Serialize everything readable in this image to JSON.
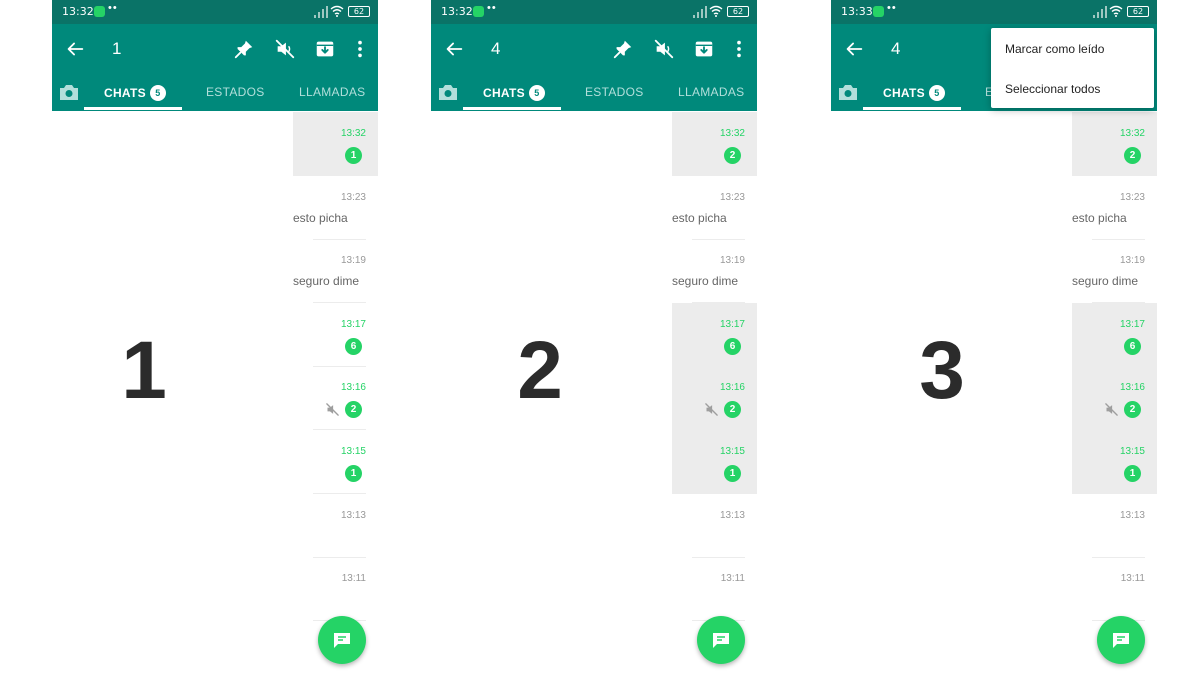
{
  "colors": {
    "status_bar": "#0a7367",
    "toolbar": "#00897b",
    "accent_green": "#25d366",
    "selected_row": "#ececec"
  },
  "tabs": {
    "chats_label": "CHATS",
    "chats_badge": "5",
    "states_label": "ESTADOS",
    "calls_label": "LLAMADAS"
  },
  "steps": [
    {
      "number": "1",
      "status_time": "13:32",
      "battery": "62",
      "selected_count": "1",
      "rows": [
        {
          "time": "13:32",
          "badge": "1",
          "unread": true,
          "selected": true
        },
        {
          "time": "13:23",
          "preview": "esto picha"
        },
        {
          "time": "13:19",
          "preview": "seguro dime"
        },
        {
          "time": "13:17",
          "badge": "6",
          "unread": true
        },
        {
          "time": "13:16",
          "badge": "2",
          "unread": true,
          "muted": true
        },
        {
          "time": "13:15",
          "badge": "1",
          "unread": true
        },
        {
          "time": "13:13"
        },
        {
          "time": "13:11"
        }
      ]
    },
    {
      "number": "2",
      "status_time": "13:32",
      "battery": "62",
      "selected_count": "4",
      "rows": [
        {
          "time": "13:32",
          "badge": "2",
          "unread": true,
          "selected": true
        },
        {
          "time": "13:23",
          "preview": "esto picha"
        },
        {
          "time": "13:19",
          "preview": "seguro dime"
        },
        {
          "time": "13:17",
          "badge": "6",
          "unread": true,
          "selected": true
        },
        {
          "time": "13:16",
          "badge": "2",
          "unread": true,
          "muted": true,
          "selected": true
        },
        {
          "time": "13:15",
          "badge": "1",
          "unread": true,
          "selected": true
        },
        {
          "time": "13:13"
        },
        {
          "time": "13:11"
        }
      ]
    },
    {
      "number": "3",
      "status_time": "13:33",
      "battery": "62",
      "selected_count": "4",
      "menu": {
        "mark_read": "Marcar como leído",
        "select_all": "Seleccionar todos"
      },
      "rows": [
        {
          "time": "13:32",
          "badge": "2",
          "unread": true,
          "selected": true
        },
        {
          "time": "13:23",
          "preview": "esto picha"
        },
        {
          "time": "13:19",
          "preview": "seguro dime"
        },
        {
          "time": "13:17",
          "badge": "6",
          "unread": true,
          "selected": true
        },
        {
          "time": "13:16",
          "badge": "2",
          "unread": true,
          "muted": true,
          "selected": true
        },
        {
          "time": "13:15",
          "badge": "1",
          "unread": true,
          "selected": true
        },
        {
          "time": "13:13"
        },
        {
          "time": "13:11"
        }
      ]
    }
  ]
}
